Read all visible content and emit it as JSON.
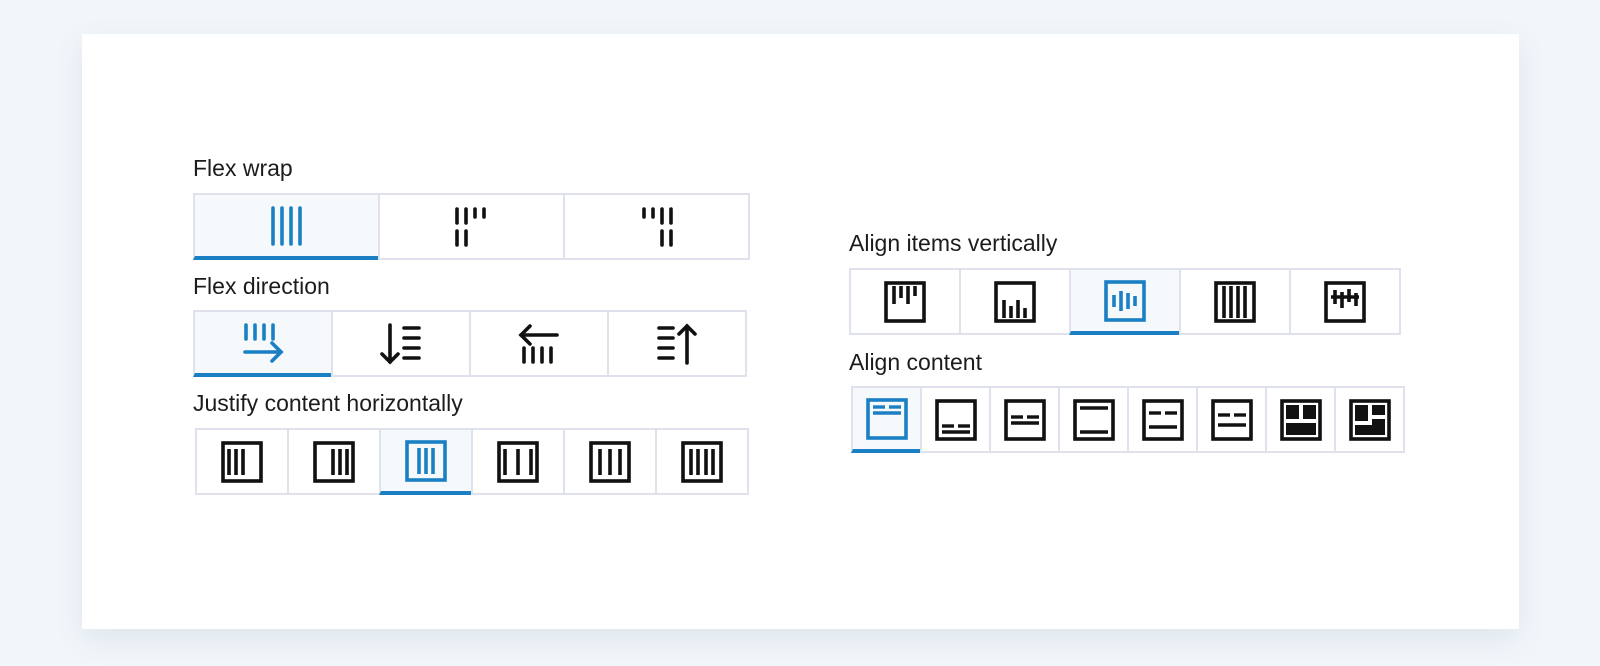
{
  "colors": {
    "accent": "#1b7fc4",
    "border": "#dfe2ec",
    "icon": "#111111"
  },
  "flex_wrap": {
    "label": "Flex wrap",
    "options": [
      {
        "icon": "flex-nowrap-icon",
        "selected": true
      },
      {
        "icon": "flex-wrap-icon",
        "selected": false
      },
      {
        "icon": "flex-wrap-reverse-icon",
        "selected": false
      }
    ]
  },
  "flex_direction": {
    "label": "Flex direction",
    "options": [
      {
        "icon": "direction-row-icon",
        "selected": true
      },
      {
        "icon": "direction-column-icon",
        "selected": false
      },
      {
        "icon": "direction-row-reverse-icon",
        "selected": false
      },
      {
        "icon": "direction-column-reverse-icon",
        "selected": false
      }
    ]
  },
  "justify_content": {
    "label": "Justify content horizontally",
    "options": [
      {
        "icon": "justify-start-icon",
        "selected": false
      },
      {
        "icon": "justify-end-icon",
        "selected": false
      },
      {
        "icon": "justify-center-icon",
        "selected": true
      },
      {
        "icon": "justify-space-between-icon",
        "selected": false
      },
      {
        "icon": "justify-space-around-icon",
        "selected": false
      },
      {
        "icon": "justify-space-evenly-icon",
        "selected": false
      }
    ]
  },
  "align_items": {
    "label": "Align items vertically",
    "options": [
      {
        "icon": "align-items-start-icon",
        "selected": false
      },
      {
        "icon": "align-items-end-icon",
        "selected": false
      },
      {
        "icon": "align-items-center-icon",
        "selected": true
      },
      {
        "icon": "align-items-stretch-icon",
        "selected": false
      },
      {
        "icon": "align-items-baseline-icon",
        "selected": false
      }
    ]
  },
  "align_content": {
    "label": "Align content",
    "options": [
      {
        "icon": "align-content-start-icon",
        "selected": true
      },
      {
        "icon": "align-content-end-icon",
        "selected": false
      },
      {
        "icon": "align-content-center-icon",
        "selected": false
      },
      {
        "icon": "align-content-space-between-icon",
        "selected": false
      },
      {
        "icon": "align-content-space-around-icon",
        "selected": false
      },
      {
        "icon": "align-content-space-evenly-icon",
        "selected": false
      },
      {
        "icon": "align-content-stretch-icon",
        "selected": false
      },
      {
        "icon": "align-content-masonry-icon",
        "selected": false
      }
    ]
  }
}
